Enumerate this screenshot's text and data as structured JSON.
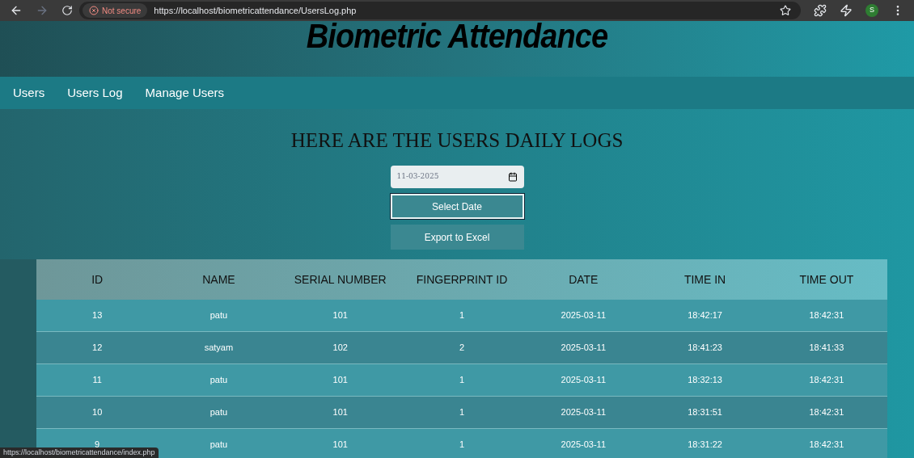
{
  "browser": {
    "security_label": "Not secure",
    "url": "https://localhost/biometricattendance/UsersLog.php",
    "profile_initial": "S",
    "status_url": "https://localhost/biometricattendance/index.php"
  },
  "header": {
    "title": "Biometric Attendance"
  },
  "nav": [
    "Users",
    "Users Log",
    "Manage Users"
  ],
  "page_title": "HERE ARE THE USERS DAILY LOGS",
  "date_field": {
    "value": "11-03-2025"
  },
  "buttons": [
    {
      "label": "Select Date",
      "kind": "focused"
    },
    {
      "label": "Export to Excel",
      "kind": "plain"
    }
  ],
  "table": {
    "columns": [
      "ID",
      "NAME",
      "SERIAL NUMBER",
      "FINGERPRINT ID",
      "DATE",
      "TIME IN",
      "TIME OUT"
    ],
    "rows": [
      [
        "13",
        "patu",
        "101",
        "1",
        "2025-03-11",
        "18:42:17",
        "18:42:31"
      ],
      [
        "12",
        "satyam",
        "102",
        "2",
        "2025-03-11",
        "18:41:23",
        "18:41:33"
      ],
      [
        "11",
        "patu",
        "101",
        "1",
        "2025-03-11",
        "18:32:13",
        "18:42:31"
      ],
      [
        "10",
        "patu",
        "101",
        "1",
        "2025-03-11",
        "18:31:51",
        "18:42:31"
      ],
      [
        "9",
        "patu",
        "101",
        "1",
        "2025-03-11",
        "18:31:22",
        "18:42:31"
      ]
    ]
  }
}
